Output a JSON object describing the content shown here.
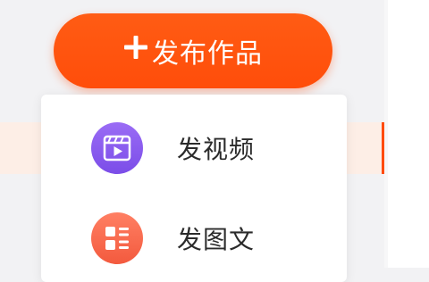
{
  "publish_button": {
    "icon": "plus-icon",
    "label": "发布作品"
  },
  "menu": {
    "items": [
      {
        "label": "发视频",
        "icon": "video-icon"
      },
      {
        "label": "发图文",
        "icon": "article-icon"
      }
    ]
  },
  "colors": {
    "accent": "#ff4d0a",
    "video_icon_bg": "#8a5cf0",
    "article_icon_bg": "#f76a4d",
    "highlight_row": "#fdeee6"
  }
}
